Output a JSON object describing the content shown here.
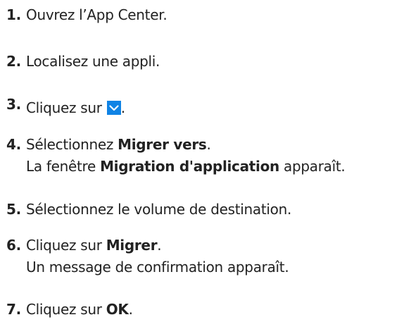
{
  "steps": [
    {
      "number": "1.",
      "text": "Ouvrez l’App Center."
    },
    {
      "number": "2.",
      "text": "Localisez une appli."
    },
    {
      "number": "3.",
      "text_before": "Cliquez sur ",
      "icon": "chevron-down-icon",
      "icon_color": "#0f83e5",
      "text_after": "."
    },
    {
      "number": "4.",
      "text_before": "Sélectionnez ",
      "bold": "Migrer vers",
      "text_after": ".",
      "line2_before": "La fenêtre ",
      "line2_bold": "Migration d'application",
      "line2_after": " apparaît."
    },
    {
      "number": "5.",
      "text": "Sélectionnez le volume de destination."
    },
    {
      "number": "6.",
      "text_before": "Cliquez sur ",
      "bold": "Migrer",
      "text_after": ".",
      "line2": "Un message de confirmation apparaît."
    },
    {
      "number": "7.",
      "text_before": "Cliquez sur ",
      "bold": "OK",
      "text_after": "."
    }
  ]
}
